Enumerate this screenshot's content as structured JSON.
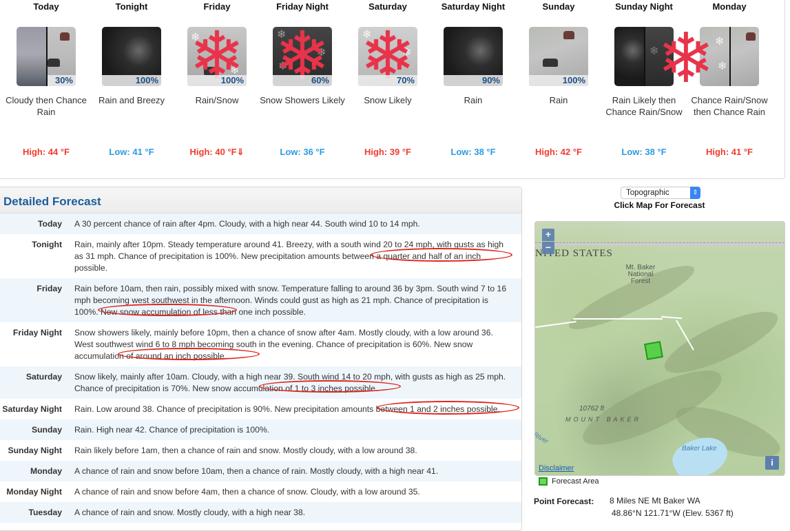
{
  "periods": [
    {
      "name": "Today",
      "pop": "30%",
      "desc": "Cloudy then Chance Rain",
      "temp": "High: 44 °F",
      "kind": "high",
      "icon": "cloudy-then-rain-icon"
    },
    {
      "name": "Tonight",
      "pop": "100%",
      "desc": "Rain and Breezy",
      "temp": "Low: 41 °F",
      "kind": "low",
      "icon": "rain-night-icon"
    },
    {
      "name": "Friday",
      "pop": "100%",
      "desc": "Rain/Snow",
      "temp": "High: 40 °F⇓",
      "kind": "high",
      "icon": "rain-snow-icon"
    },
    {
      "name": "Friday Night",
      "pop": "60%",
      "desc": "Snow Showers Likely",
      "temp": "Low: 36 °F",
      "kind": "low",
      "icon": "snow-night-icon"
    },
    {
      "name": "Saturday",
      "pop": "70%",
      "desc": "Snow Likely",
      "temp": "High: 39 °F",
      "kind": "high",
      "icon": "snow-icon"
    },
    {
      "name": "Saturday Night",
      "pop": "90%",
      "desc": "Rain",
      "temp": "Low: 38 °F",
      "kind": "low",
      "icon": "rain-night-icon"
    },
    {
      "name": "Sunday",
      "pop": "100%",
      "desc": "Rain",
      "temp": "High: 42 °F",
      "kind": "high",
      "icon": "rain-icon"
    },
    {
      "name": "Sunday Night",
      "pop": "",
      "desc": "Rain Likely then Chance Rain/Snow",
      "temp": "Low: 38 °F",
      "kind": "low",
      "icon": "rain-then-snow-night-icon"
    },
    {
      "name": "Monday",
      "pop": "",
      "desc": "Chance Rain/Snow then Chance Rain",
      "temp": "High: 41 °F",
      "kind": "high",
      "icon": "rain-snow-then-rain-icon"
    }
  ],
  "detailed": {
    "title": "Detailed Forecast",
    "rows": [
      {
        "label": "Today",
        "text": "A 30 percent chance of rain after 4pm. Cloudy, with a high near 44. South wind 10 to 14 mph."
      },
      {
        "label": "Tonight",
        "text": "Rain, mainly after 10pm. Steady temperature around 41. Breezy, with a south wind 20 to 24 mph, with gusts as high as 31 mph. Chance of precipitation is 100%. New precipitation amounts between a quarter and half of an inch possible."
      },
      {
        "label": "Friday",
        "text": "Rain before 10am, then rain, possibly mixed with snow. Temperature falling to around 36 by 3pm. South wind 7 to 16 mph becoming west southwest in the afternoon. Winds could gust as high as 21 mph. Chance of precipitation is 100%. New snow accumulation of less than one inch possible."
      },
      {
        "label": "Friday Night",
        "text": "Snow showers likely, mainly before 10pm, then a chance of snow after 4am. Mostly cloudy, with a low around 36. West southwest wind 6 to 8 mph becoming south in the evening. Chance of precipitation is 60%. New snow accumulation of around an inch possible."
      },
      {
        "label": "Saturday",
        "text": "Snow likely, mainly after 10am. Cloudy, with a high near 39. South wind 14 to 20 mph, with gusts as high as 25 mph. Chance of precipitation is 70%. New snow accumulation of 1 to 3 inches possible."
      },
      {
        "label": "Saturday Night",
        "text": "Rain. Low around 38. Chance of precipitation is 90%. New precipitation amounts between 1 and 2 inches possible."
      },
      {
        "label": "Sunday",
        "text": "Rain. High near 42. Chance of precipitation is 100%."
      },
      {
        "label": "Sunday Night",
        "text": "Rain likely before 1am, then a chance of rain and snow. Mostly cloudy, with a low around 38."
      },
      {
        "label": "Monday",
        "text": "A chance of rain and snow before 10am, then a chance of rain. Mostly cloudy, with a high near 41."
      },
      {
        "label": "Monday Night",
        "text": "A chance of rain and snow before 4am, then a chance of snow. Cloudy, with a low around 35."
      },
      {
        "label": "Tuesday",
        "text": "A chance of rain and snow. Mostly cloudy, with a high near 38."
      }
    ]
  },
  "map": {
    "type_selected": "Topographic",
    "click_hint": "Click Map For Forecast",
    "zoom_in": "+",
    "zoom_out": "−",
    "country_label": "NITED STATES",
    "forest_label": "Mt. Baker National Forest",
    "peak_elev": "10762 ft",
    "peak_name": "MOUNT BAKER",
    "river_label": "River",
    "lake_label": "Baker Lake",
    "disclaimer": "Disclaimer",
    "info": "i",
    "legend": "Forecast Area"
  },
  "point_forecast": {
    "label": "Point Forecast:",
    "place": "8 Miles NE Mt Baker WA",
    "coords": "48.86°N 121.71°W (Elev. 5367 ft)"
  },
  "colors": {
    "high_temp": "#ee3d2f",
    "low_temp": "#2b9be0",
    "pop": "#1c4e86",
    "header": "#1c5e9a",
    "annotation": "#e0251c"
  }
}
